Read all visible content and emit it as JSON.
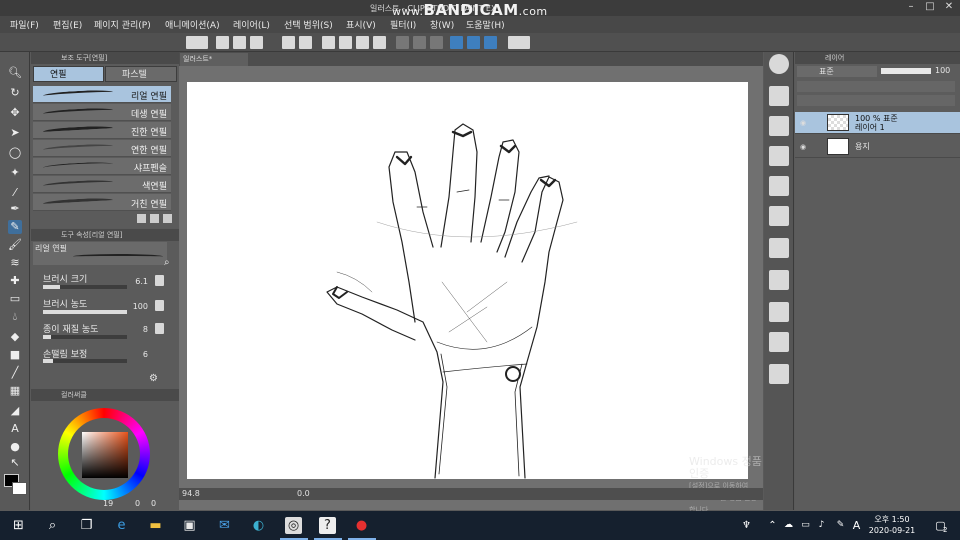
{
  "window": {
    "title": "일러스트 - CLIP STUDIO PAINT EX",
    "recorder_prefix": "www.",
    "recorder_brand": "BANDICAM",
    "recorder_suffix": ".com",
    "minimize": "–",
    "maximize": "□",
    "close": "✕"
  },
  "menu": [
    {
      "label": "파일(F)"
    },
    {
      "label": "편집(E)"
    },
    {
      "label": "페이지 관리(P)"
    },
    {
      "label": "애니메이션(A)"
    },
    {
      "label": "레이어(L)"
    },
    {
      "label": "선택 범위(S)"
    },
    {
      "label": "표시(V)"
    },
    {
      "label": "필터(I)"
    },
    {
      "label": "창(W)"
    },
    {
      "label": "도움말(H)"
    }
  ],
  "subtool_panel": {
    "header": "보조 도구[연필]",
    "tabs": [
      "연필",
      "파스텔"
    ],
    "brushes": [
      {
        "name": "리얼 연필",
        "selected": true
      },
      {
        "name": "데생 연필",
        "selected": false
      },
      {
        "name": "진한 연필",
        "selected": false
      },
      {
        "name": "연한 연필",
        "selected": false
      },
      {
        "name": "샤프펜슬",
        "selected": false
      },
      {
        "name": "색연필",
        "selected": false
      },
      {
        "name": "거친 연필",
        "selected": false
      }
    ]
  },
  "tool_property": {
    "header": "도구 속성[리얼 연필]",
    "preset_name": "리얼 연필",
    "props": [
      {
        "label": "브러시 크기",
        "value": "6.1",
        "level": 0.2
      },
      {
        "label": "브러시 농도",
        "value": "100",
        "level": 1.0
      },
      {
        "label": "종이 재질 농도",
        "value": "8",
        "level": 0.1
      },
      {
        "label": "손떨림 보정",
        "value": "6",
        "level": 0.12
      }
    ]
  },
  "color_panel": {
    "header": "컬러써클",
    "hsv_readout": "19",
    "zero_a": "0",
    "zero_b": "0",
    "main_color": "#000000",
    "sub_color": "#ffffff"
  },
  "canvas": {
    "doc_tab": "일러스트*",
    "zoom": "94.8",
    "rotation": "0.0"
  },
  "watermark": {
    "line1": "Windows 정품 인증",
    "line2": "[설정]으로 이동하여 Windows를 정품 인증합니다."
  },
  "layer_panel": {
    "header": "레이어",
    "blend_mode": "표준",
    "opacity": "100",
    "layers": [
      {
        "line1": "100 % 표준",
        "line2": "레이어 1",
        "selected": true
      },
      {
        "line1": "용지",
        "line2": "",
        "selected": false
      }
    ]
  },
  "taskbar": {
    "time": "오후 1:50",
    "date": "2020-09-21",
    "ime": "A",
    "notification_count": "2"
  },
  "colors": {
    "accent": "#3f6f9c",
    "selection": "#a9c4de",
    "taskbar": "#15202e"
  }
}
